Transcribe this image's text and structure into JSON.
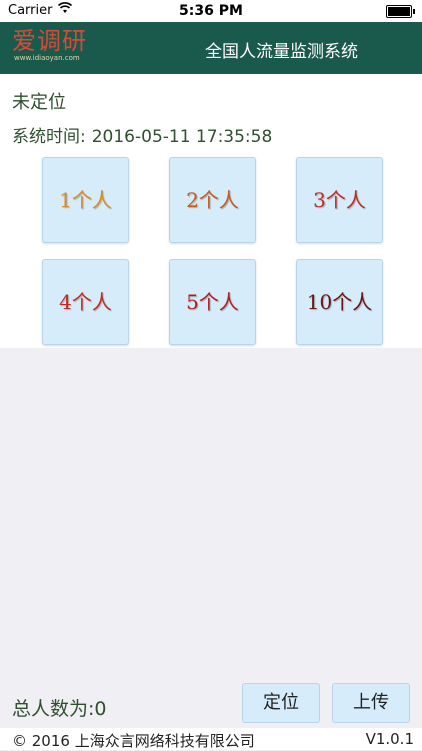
{
  "status_bar": {
    "carrier": "Carrier",
    "time": "5:36 PM"
  },
  "navbar": {
    "logo_brand": "爱调研",
    "logo_url": "www.idiaoyan.com",
    "title": "全国人流量监测系统"
  },
  "location": {
    "status": "未定位",
    "time_label": "系统时间:",
    "time_value": "2016-05-11 17:35:58"
  },
  "people_buttons": [
    {
      "label": "1个人",
      "color": "#e08a1e"
    },
    {
      "label": "2个人",
      "color": "#c85a14"
    },
    {
      "label": "3个人",
      "color": "#c42a22"
    },
    {
      "label": "4个人",
      "color": "#c42a22"
    },
    {
      "label": "5个人",
      "color": "#b01e1e"
    },
    {
      "label": "10个人",
      "color": "#6a1414"
    }
  ],
  "bottom": {
    "total_label": "总人数为:0",
    "locate_button": "定位",
    "upload_button": "上传"
  },
  "footer": {
    "copyright": "©  2016 上海众言网络科技有限公司",
    "version": "V1.0.1"
  }
}
